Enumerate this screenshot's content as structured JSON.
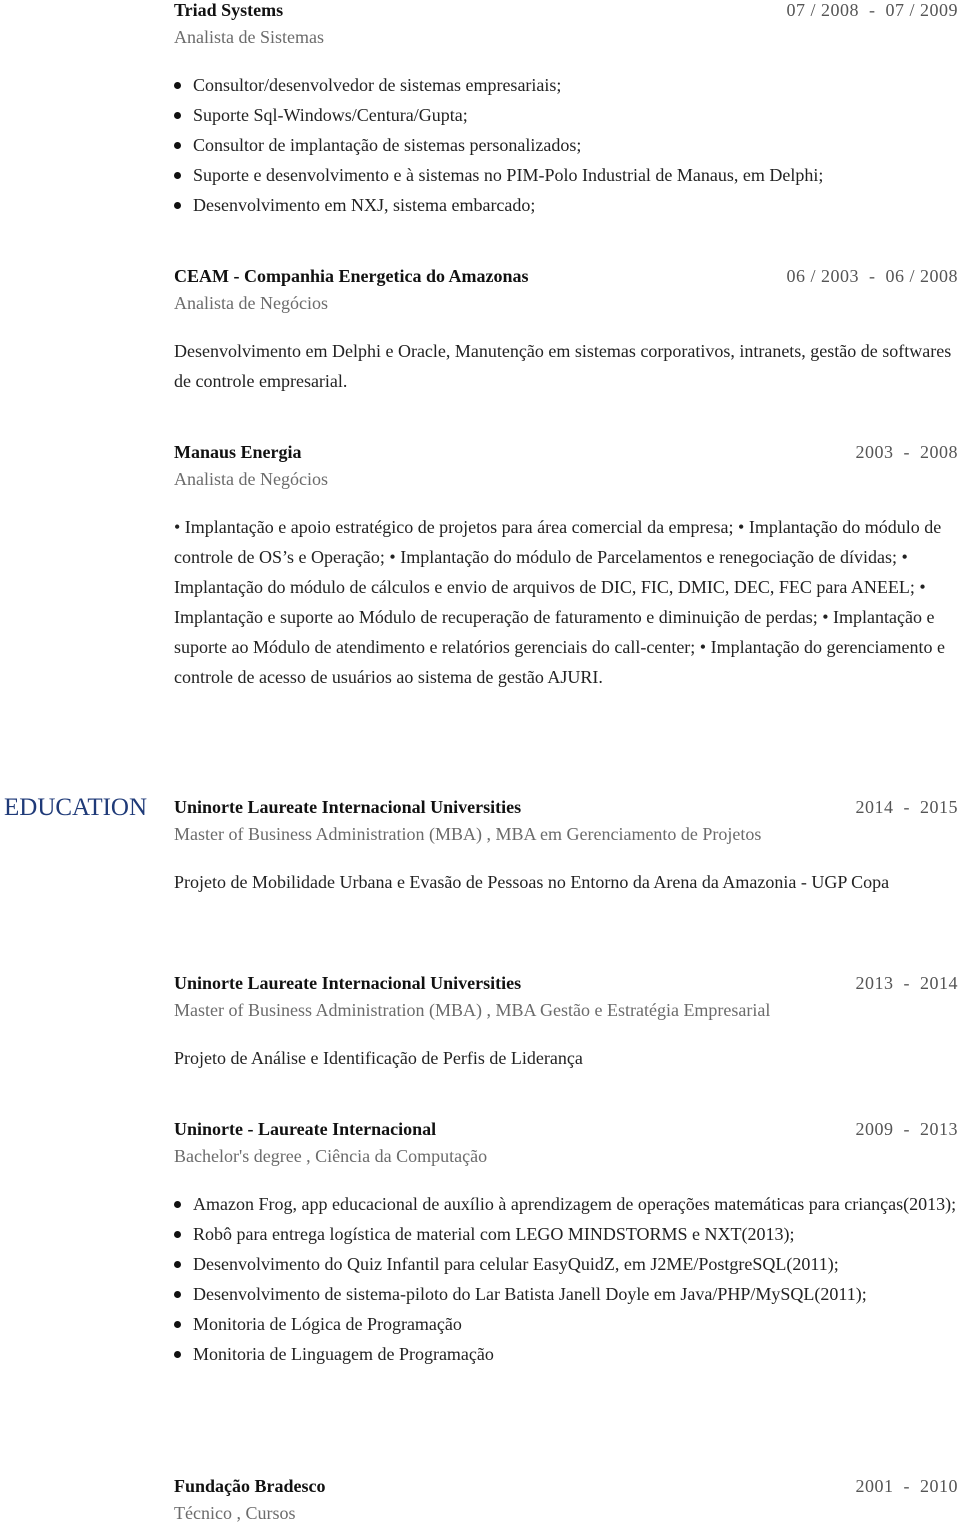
{
  "experience": [
    {
      "org": "Triad Systems",
      "dates": "07 / 2008  -  07 / 2009",
      "role": "Analista de Sistemas",
      "bullets": [
        "Consultor/desenvolvedor de sistemas empresariais;",
        "Suporte Sql-Windows/Centura/Gupta;",
        "Consultor de implantação de sistemas personalizados;",
        "Suporte e desenvolvimento e à sistemas no PIM-Polo Industrial de Manaus, em Delphi;",
        "Desenvolvimento em NXJ, sistema embarcado;"
      ]
    },
    {
      "org": "CEAM - Companhia Energetica do Amazonas",
      "dates": "06 / 2003  -  06 / 2008",
      "role": "Analista de Negócios",
      "description": "Desenvolvimento em Delphi e Oracle, Manutenção em sistemas corporativos, intranets, gestão de softwares de controle empresarial."
    },
    {
      "org": "Manaus Energia",
      "dates": "2003  -  2008",
      "role": "Analista de Negócios",
      "description": "• Implantação e apoio estratégico de projetos para área comercial da empresa; • Implantação do módulo de controle de OS’s e Operação; • Implantação do módulo de Parcelamentos e renegociação de dívidas; • Implantação do módulo de cálculos e envio de arquivos de DIC, FIC, DMIC, DEC, FEC para ANEEL; • Implantação e suporte ao Módulo de recuperação de faturamento e diminuição de perdas; • Implantação e suporte ao Módulo de atendimento e relatórios gerenciais do call-center; • Implantação do gerenciamento e controle de acesso de usuários ao sistema de gestão AJURI."
    }
  ],
  "education_section": {
    "label": "EDUCATION",
    "label_color": "#1f3a78",
    "entries": [
      {
        "org": "Uninorte Laureate Internacional Universities",
        "dates": "2014  -  2015",
        "role": "Master of Business Administration (MBA) , MBA em Gerenciamento de Projetos",
        "description": "Projeto de Mobilidade Urbana e Evasão de Pessoas no Entorno da Arena da Amazonia - UGP Copa"
      },
      {
        "org": "Uninorte Laureate Internacional Universities",
        "dates": "2013  -  2014",
        "role": "Master of Business Administration (MBA) , MBA Gestão e Estratégia Empresarial",
        "description": "Projeto de Análise e Identificação de Perfis de Liderança"
      },
      {
        "org": "Uninorte - Laureate Internacional",
        "dates": "2009  -  2013",
        "role": "Bachelor's degree , Ciência da Computação",
        "bullets": [
          "Amazon Frog, app educacional de auxílio à aprendizagem de operações matemáticas para crianças(2013);",
          "Robô para entrega logística de material com LEGO MINDSTORMS e NXT(2013);",
          "Desenvolvimento do Quiz Infantil para celular EasyQuidZ, em J2ME/PostgreSQL(2011);",
          "Desenvolvimento de sistema-piloto do Lar Batista Janell Doyle em Java/PHP/MySQL(2011);",
          "Monitoria de Lógica de Programação",
          "Monitoria de Linguagem de Programação"
        ]
      },
      {
        "org": "Fundação Bradesco",
        "dates": "2001  -  2010",
        "role": "Técnico , Cursos"
      }
    ]
  }
}
